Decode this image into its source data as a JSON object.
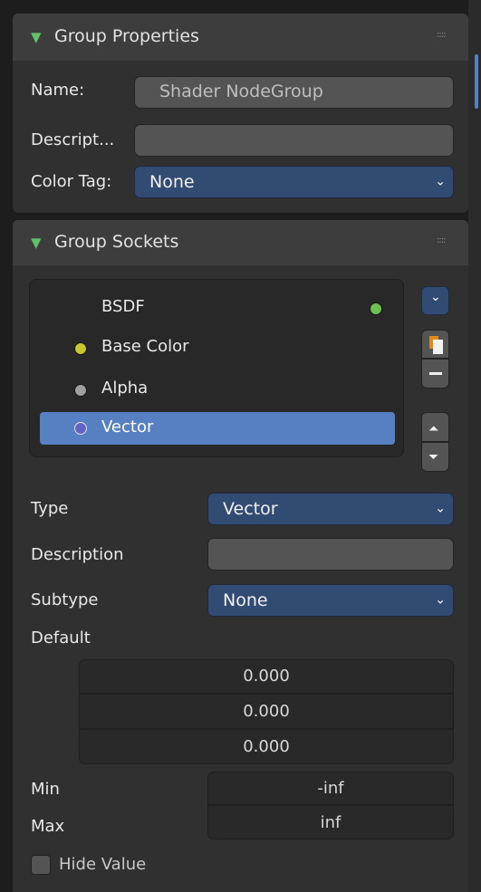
{
  "group_properties": {
    "title": "Group Properties",
    "name_label": "Name:",
    "name_value": "Shader NodeGroup",
    "description_label": "Descript...",
    "description_value": "",
    "color_tag_label": "Color Tag:",
    "color_tag_value": "None"
  },
  "group_sockets": {
    "title": "Group Sockets",
    "items": [
      {
        "label": "BSDF",
        "color": "#6cc352"
      },
      {
        "label": "Base Color",
        "color": "#c8c72e"
      },
      {
        "label": "Alpha",
        "color": "#a0a0a0"
      },
      {
        "label": "Vector",
        "color": "#6363c7"
      }
    ],
    "type_label": "Type",
    "type_value": "Vector",
    "description_label": "Description",
    "description_value": "",
    "subtype_label": "Subtype",
    "subtype_value": "None",
    "default_label": "Default",
    "default_values": [
      "0.000",
      "0.000",
      "0.000"
    ],
    "min_label": "Min",
    "min_value": "-inf",
    "max_label": "Max",
    "max_value": "inf",
    "hide_value_label": "Hide Value",
    "hide_value_checked": false
  },
  "icons": {
    "expand": "triangle-down-icon",
    "drag": "grip-icon",
    "dropdown": "chevron-down-icon",
    "copy": "copy-icon",
    "remove": "minus-icon",
    "move_up": "triangle-up-icon",
    "move_down": "triangle-down-icon"
  },
  "colors": {
    "accent_selected": "#5680c2",
    "dropdown": "#324b73"
  }
}
